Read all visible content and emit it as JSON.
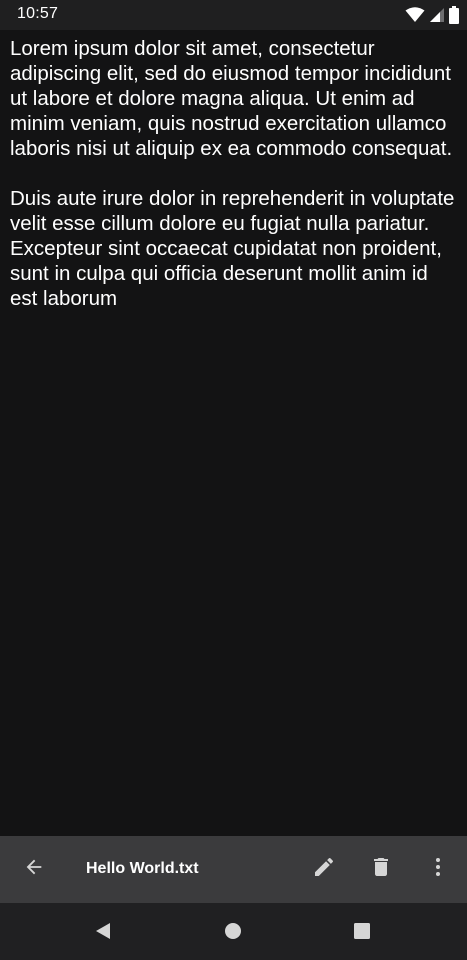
{
  "status_bar": {
    "time": "10:57",
    "icons": [
      "wifi-icon",
      "cellular-signal-icon",
      "battery-icon"
    ]
  },
  "document": {
    "paragraphs": [
      "Lorem ipsum dolor sit amet, consectetur adipiscing elit, sed do eiusmod tempor incididunt ut labore et dolore magna aliqua. Ut enim ad minim veniam, quis nostrud exercitation ullamco laboris nisi ut aliquip ex ea commodo consequat.",
      "Duis aute irure dolor in reprehenderit in voluptate velit esse cillum dolore eu fugiat nulla pariatur. Excepteur sint occaecat cupidatat non proident, sunt in culpa qui officia deserunt mollit anim id est laborum"
    ]
  },
  "toolbar": {
    "title": "Hello World.txt",
    "icons": [
      "back-arrow-icon",
      "edit-pencil-icon",
      "delete-trash-icon",
      "more-vert-icon"
    ]
  },
  "navigation_bar": {
    "icons": [
      "nav-back-triangle-icon",
      "nav-home-circle-icon",
      "nav-recents-square-icon"
    ]
  },
  "colors": {
    "background": "#131314",
    "status_bar": "#1f1f20",
    "toolbar": "#3b3b3d",
    "nav_bar": "#202022",
    "text": "#ffffff",
    "icon": "#d6d6d6"
  }
}
